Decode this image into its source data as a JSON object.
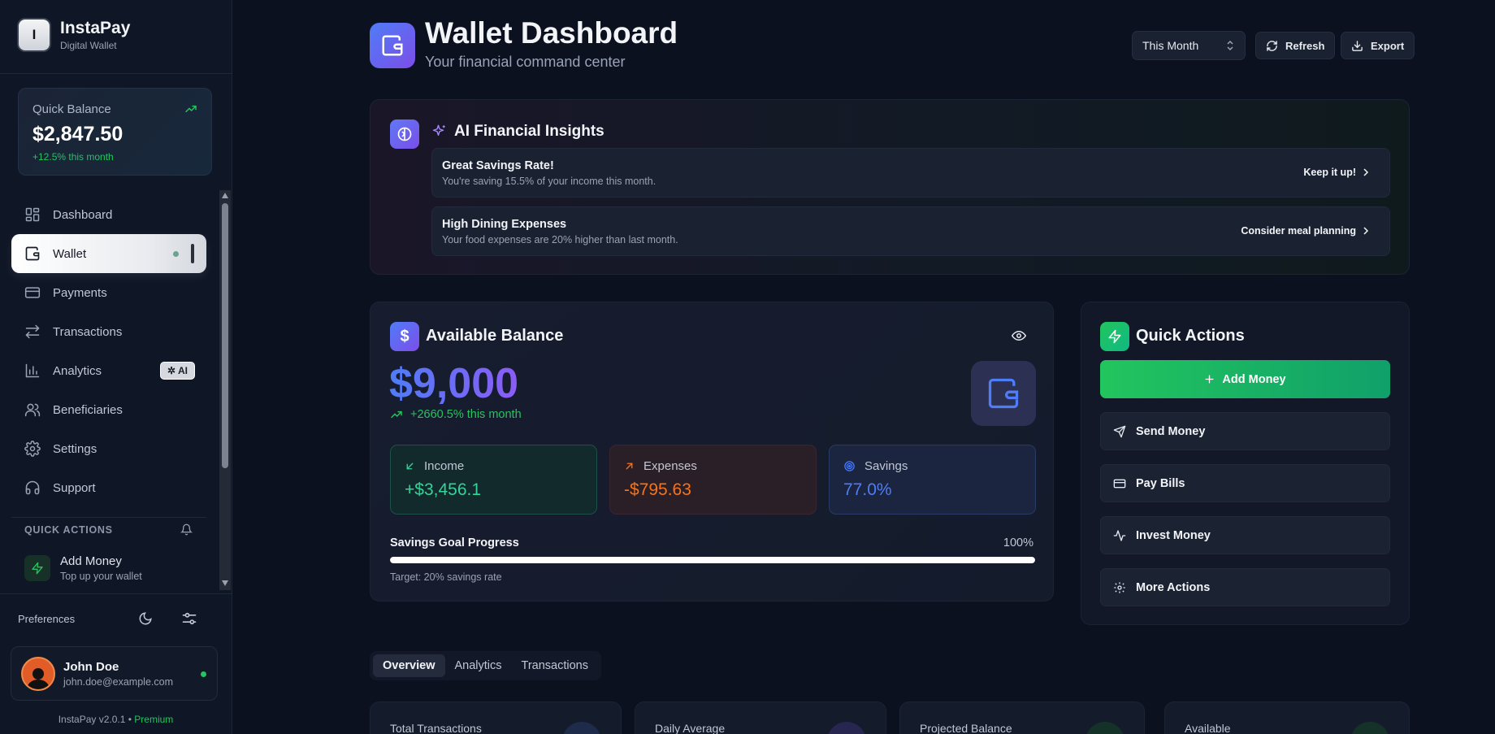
{
  "brand": {
    "logo_letter": "I",
    "name": "InstaPay",
    "subtitle": "Digital Wallet"
  },
  "quick_balance": {
    "label": "Quick Balance",
    "amount": "$2,847.50",
    "change": "+12.5% this month"
  },
  "sidebar": {
    "nav": [
      {
        "label": "Dashboard",
        "icon": "dashboard-icon"
      },
      {
        "label": "Wallet",
        "icon": "wallet-icon",
        "active": true
      },
      {
        "label": "Payments",
        "icon": "card-icon"
      },
      {
        "label": "Transactions",
        "icon": "transfer-icon"
      },
      {
        "label": "Analytics",
        "icon": "chart-icon",
        "badge": "AI"
      },
      {
        "label": "Beneficiaries",
        "icon": "users-icon"
      },
      {
        "label": "Settings",
        "icon": "gear-icon"
      },
      {
        "label": "Support",
        "icon": "headset-icon"
      }
    ],
    "quick_actions": {
      "header": "QUICK ACTIONS",
      "item": {
        "title": "Add Money",
        "subtitle": "Top up your wallet"
      }
    },
    "preferences_label": "Preferences",
    "user": {
      "name": "John Doe",
      "email": "john.doe@example.com"
    },
    "version": "InstaPay v2.0.1 •",
    "plan": "Premium"
  },
  "header": {
    "title": "Wallet Dashboard",
    "subtitle": "Your financial command center",
    "period": "This Month",
    "refresh_label": "Refresh",
    "export_label": "Export"
  },
  "insights": {
    "title": "AI Financial Insights",
    "items": [
      {
        "title": "Great Savings Rate!",
        "description": "You're saving 15.5% of your income this month.",
        "action": "Keep it up!"
      },
      {
        "title": "High Dining Expenses",
        "description": "Your food expenses are 20% higher than last month.",
        "action": "Consider meal planning"
      }
    ]
  },
  "balance": {
    "title": "Available Balance",
    "currency_symbol": "$",
    "amount": "$9,000",
    "change": "+2660.5% this month",
    "income": {
      "label": "Income",
      "value": "+$3,456.1"
    },
    "expenses": {
      "label": "Expenses",
      "value": "-$795.63"
    },
    "savings": {
      "label": "Savings",
      "value": "77.0%"
    },
    "goal": {
      "label": "Savings Goal Progress",
      "percent_text": "100%",
      "progress": 1.0,
      "target": "Target: 20% savings rate"
    }
  },
  "quick_actions": {
    "title": "Quick Actions",
    "primary": "Add Money",
    "buttons": [
      {
        "label": "Send Money",
        "icon": "send-icon"
      },
      {
        "label": "Pay Bills",
        "icon": "card-icon"
      },
      {
        "label": "Invest Money",
        "icon": "activity-icon"
      },
      {
        "label": "More Actions",
        "icon": "gear-icon"
      }
    ]
  },
  "tabs": [
    {
      "label": "Overview",
      "active": true
    },
    {
      "label": "Analytics"
    },
    {
      "label": "Transactions"
    }
  ],
  "stats": [
    {
      "label": "Total Transactions"
    },
    {
      "label": "Daily Average"
    },
    {
      "label": "Projected Balance"
    },
    {
      "label": "Available"
    }
  ],
  "colors": {
    "accent_blue": "#4f7cf7",
    "accent_purple": "#7c4ee9",
    "success": "#22c55e",
    "warning": "#f97316"
  }
}
